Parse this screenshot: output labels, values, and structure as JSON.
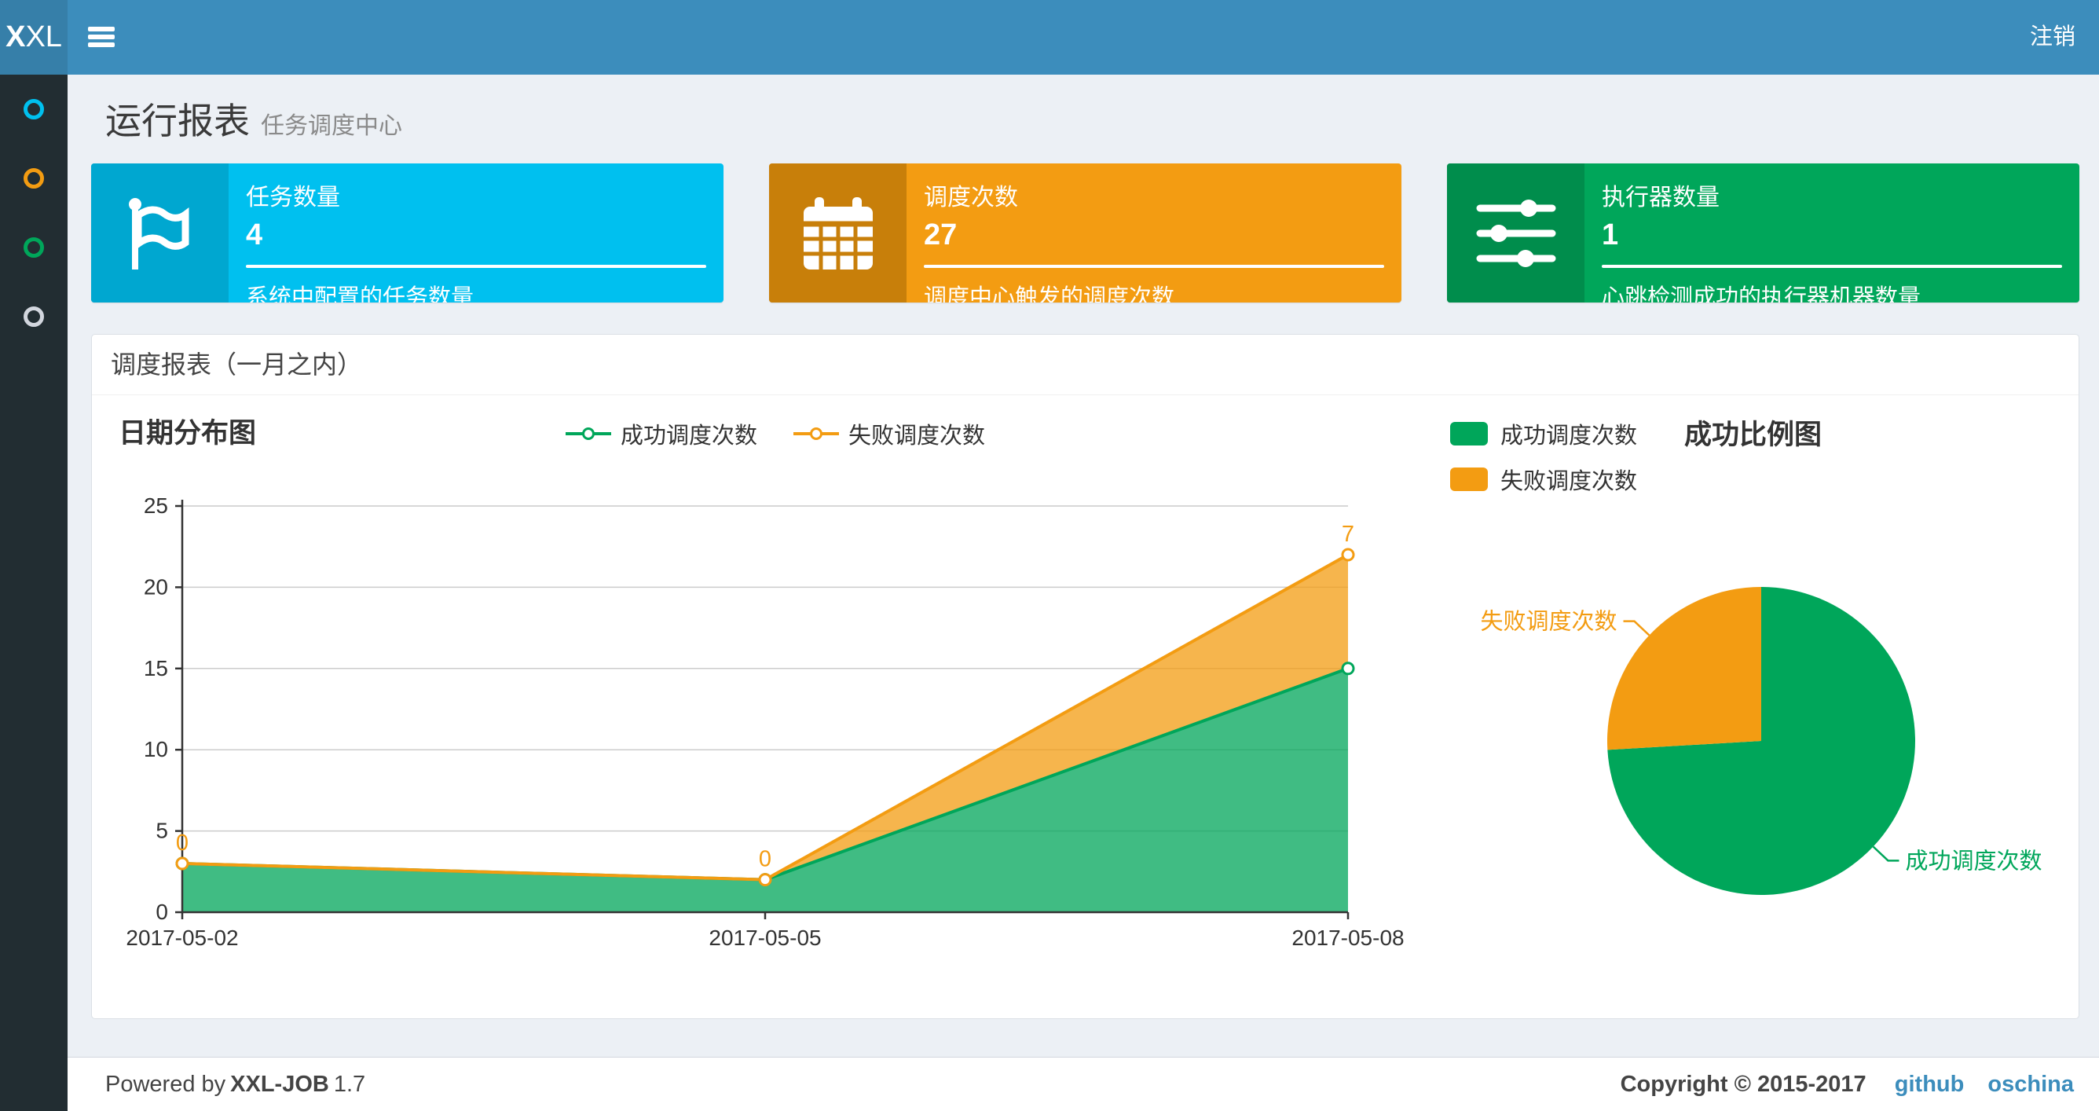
{
  "navbar": {
    "logo_bold": "X",
    "logo_rest": "XL",
    "logout_label": "注销"
  },
  "sidebar": {
    "items": [
      {
        "name": "menu-item-1",
        "color": "#00c0ef"
      },
      {
        "name": "menu-item-2",
        "color": "#f39c12"
      },
      {
        "name": "menu-item-3",
        "color": "#00a65a"
      },
      {
        "name": "menu-item-4",
        "color": "#d2d6de"
      }
    ]
  },
  "page": {
    "title": "运行报表",
    "subtitle": "任务调度中心"
  },
  "info_boxes": [
    {
      "icon": "flag-icon",
      "label": "任务数量",
      "value": "4",
      "desc": "系统中配置的任务数量",
      "bg": "#00c0ef",
      "icon_bg": "#00a7d0"
    },
    {
      "icon": "calendar-icon",
      "label": "调度次数",
      "value": "27",
      "desc": "调度中心触发的调度次数",
      "bg": "#f39c12",
      "icon_bg": "#c87f0a"
    },
    {
      "icon": "sliders-icon",
      "label": "执行器数量",
      "value": "1",
      "desc": "心跳检测成功的执行器机器数量",
      "bg": "#00a65a",
      "icon_bg": "#008d4c"
    }
  ],
  "panel": {
    "title": "调度报表（一月之内）"
  },
  "chart_data": [
    {
      "type": "area",
      "title": "日期分布图",
      "categories": [
        "2017-05-02",
        "2017-05-05",
        "2017-05-08"
      ],
      "series": [
        {
          "name": "成功调度次数",
          "color": "#00a65a",
          "fill": "rgba(0,166,90,0.75)",
          "values": [
            3,
            2,
            15
          ]
        },
        {
          "name": "失败调度次数",
          "color": "#f39c12",
          "fill": "rgba(243,156,18,0.75)",
          "values": [
            0,
            0,
            7
          ]
        }
      ],
      "stacked": true,
      "point_labels_series": "失败调度次数",
      "point_labels": [
        0,
        0,
        7
      ],
      "ylim": [
        0,
        25
      ],
      "yticks": [
        0,
        5,
        10,
        15,
        20,
        25
      ],
      "grid": true,
      "legend_position": "top-center"
    },
    {
      "type": "pie",
      "title": "成功比例图",
      "slices": [
        {
          "label": "成功调度次数",
          "value": 20,
          "color": "#00a65a"
        },
        {
          "label": "失败调度次数",
          "value": 7,
          "color": "#f39c12"
        }
      ],
      "start_angle": "top",
      "direction": "clockwise",
      "legend_position": "top-left"
    }
  ],
  "footer": {
    "powered_prefix": "Powered by",
    "product": "XXL-JOB",
    "version": "1.7",
    "copyright": "Copyright © 2015-2017",
    "links": [
      {
        "label": "github"
      },
      {
        "label": "oschina"
      }
    ]
  }
}
